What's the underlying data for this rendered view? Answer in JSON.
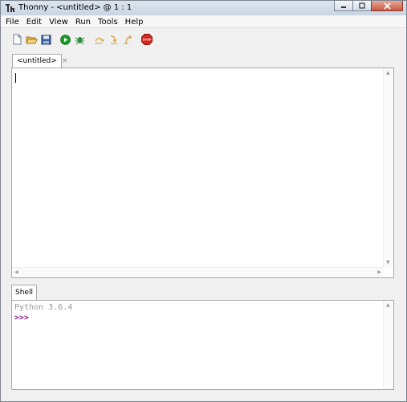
{
  "window": {
    "title": "Thonny  -  <untitled>  @  1 : 1",
    "app_icon": "thonny-logo-icon",
    "controls": [
      "minimize-icon",
      "maximize-icon",
      "close-icon"
    ]
  },
  "menu": {
    "items": [
      "File",
      "Edit",
      "View",
      "Run",
      "Tools",
      "Help"
    ]
  },
  "toolbar": {
    "buttons": [
      {
        "icon": "new-file-icon"
      },
      {
        "icon": "open-folder-icon"
      },
      {
        "icon": "save-icon"
      },
      {
        "icon": "run-icon"
      },
      {
        "icon": "debug-icon"
      },
      {
        "icon": "step-over-icon"
      },
      {
        "icon": "step-into-icon"
      },
      {
        "icon": "step-out-icon"
      },
      {
        "icon": "stop-icon"
      }
    ],
    "stop_label": "STOP"
  },
  "editor": {
    "tab_label": "<untitled>",
    "tab_close": "×",
    "content": ""
  },
  "shell": {
    "tab_label": "Shell",
    "version_line": "Python 3.6.4",
    "prompt": ">>>"
  },
  "colors": {
    "prompt": "#8b1c8b",
    "run_green": "#1e9e2a",
    "stop_red": "#d12a1f"
  }
}
